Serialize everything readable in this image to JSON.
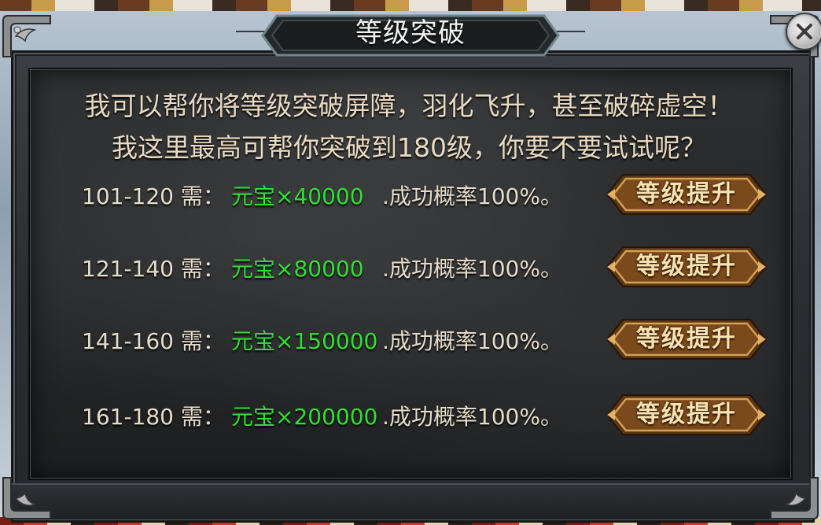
{
  "title": "等级突破",
  "intro_lines": [
    "我可以帮你将等级突破屏障，羽化飞升，甚至破碎虚空！",
    "我这里最高可帮你突破到180级，你要不要试试呢？"
  ],
  "rows": [
    {
      "range": "101-120 需：",
      "cost": "元宝×40000",
      "rate": ".成功概率100%。",
      "button": "等级提升"
    },
    {
      "range": "121-140 需：",
      "cost": "元宝×80000",
      "rate": ".成功概率100%。",
      "button": "等级提升"
    },
    {
      "range": "141-160 需：",
      "cost": "元宝×150000",
      "rate": ".成功概率100%。",
      "button": "等级提升"
    },
    {
      "range": "161-180 需：",
      "cost": "元宝×200000",
      "rate": ".成功概率100%。",
      "button": "等级提升"
    }
  ],
  "colors": {
    "cost_text": "#2fe02f",
    "body_text": "#e6dcc9",
    "button_gold": "#c08a3e"
  },
  "icons": {
    "close": "close-icon"
  }
}
